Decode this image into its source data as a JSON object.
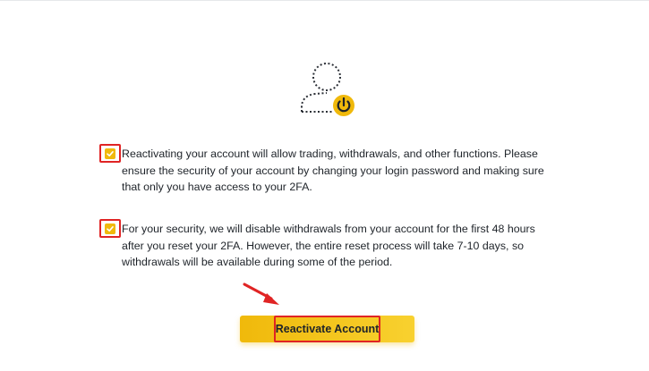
{
  "notice": {
    "icon": "user-power-icon",
    "items": [
      {
        "checked": true,
        "text": "Reactivating your account will allow trading, withdrawals, and other functions. Please ensure the security of your account by changing your login password and making sure that only you have access to your 2FA."
      },
      {
        "checked": true,
        "text": "For your security, we will disable withdrawals from your account for the first 48 hours after you reset your 2FA. However, the entire reset process will take 7-10 days, so withdrawals will be available during some of the period."
      }
    ]
  },
  "action": {
    "label": "Reactivate Account"
  },
  "colors": {
    "accent": "#f0b90b",
    "highlight": "#e02424",
    "text": "#1e2329"
  }
}
